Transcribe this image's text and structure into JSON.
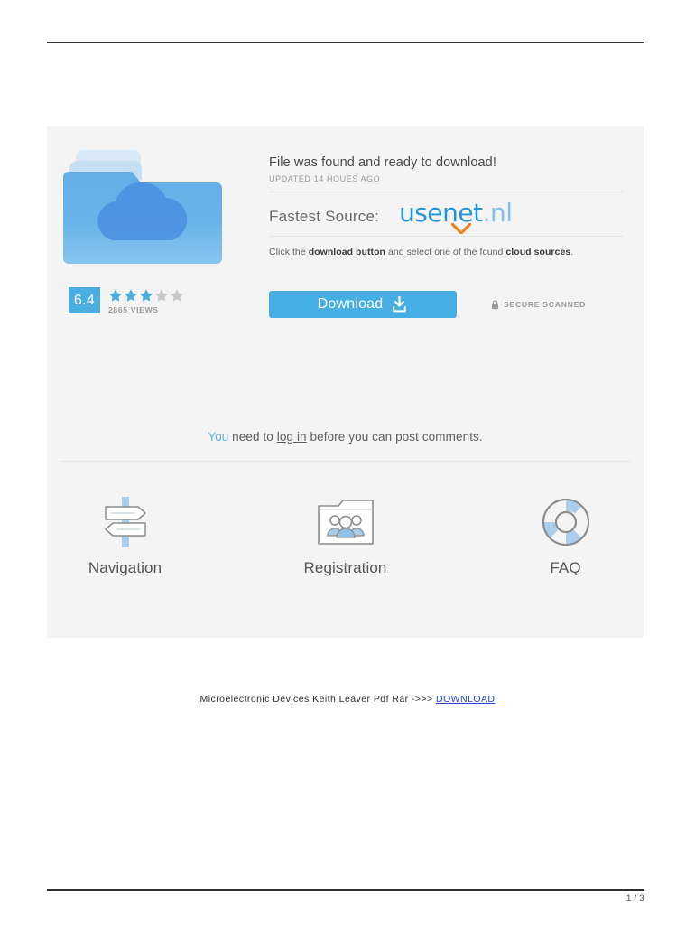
{
  "document": {
    "page_indicator": "1 / 3",
    "caption_text": "Microelectronic Devices Keith Leaver Pdf Rar ->>>",
    "caption_link": "DOWNLOAD"
  },
  "promo": {
    "headline": "File was found and ready to download!",
    "updated": "UPDATED 14 HOUES AGO",
    "source_label": "Fastest Source:",
    "source_brand": "usenet",
    "source_tld": ".nl",
    "instruction": {
      "part1": "Click the ",
      "bold1": "download button",
      "part2": " and select one of the fcund ",
      "bold2": "cloud sources",
      "part3": "."
    },
    "rating": {
      "score": "6.4",
      "stars_filled": 3,
      "stars_total": 5,
      "views": "2865 VIEWS"
    },
    "download_button_label": "Download",
    "secure_label": "SECURE SCANNED",
    "comments": {
      "accent": "You",
      "mid": " need to ",
      "link": "log in",
      "tail": " before you can post comments."
    },
    "shortcuts": [
      {
        "label": "Navigation",
        "icon": "signpost-icon"
      },
      {
        "label": "Registration",
        "icon": "folder-people-icon"
      },
      {
        "label": "FAQ",
        "icon": "life-ring-icon"
      }
    ]
  },
  "colors": {
    "accent_blue": "#45aee2",
    "logo_brand": "#2196d3",
    "logo_tld": "#7bc2e8",
    "swoosh_orange": "#e8821e",
    "card_bg": "#f4f4f4",
    "star_on": "#4aaee0",
    "star_off": "#c9c9c9",
    "link_blue": "#2a44d8"
  }
}
